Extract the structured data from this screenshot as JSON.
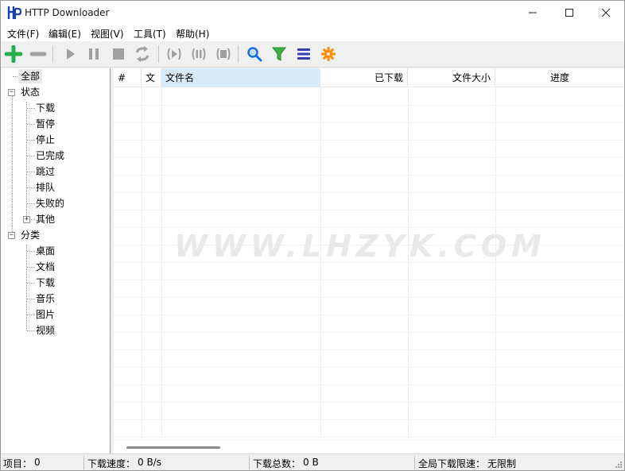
{
  "window": {
    "title": "HTTP Downloader",
    "logo_text": "HP"
  },
  "menu": {
    "items": [
      {
        "label": "文件(F)"
      },
      {
        "label": "编辑(E)"
      },
      {
        "label": "视图(V)"
      },
      {
        "label": "工具(T)"
      },
      {
        "label": "帮助(H)"
      }
    ]
  },
  "toolbar": {
    "buttons": [
      {
        "icon": "add-icon",
        "color": "#22b14c"
      },
      {
        "icon": "remove-icon",
        "color": "#a0a0a0"
      },
      {
        "icon": "start-icon",
        "color": "#a0a0a0"
      },
      {
        "icon": "pause-icon",
        "color": "#a0a0a0"
      },
      {
        "icon": "stop-icon",
        "color": "#a0a0a0"
      },
      {
        "icon": "restart-icon",
        "color": "#a0a0a0"
      },
      {
        "icon": "start-all-icon",
        "color": "#a0a0a0"
      },
      {
        "icon": "pause-all-icon",
        "color": "#a0a0a0"
      },
      {
        "icon": "stop-all-icon",
        "color": "#a0a0a0"
      },
      {
        "icon": "search-icon",
        "color": "#1e6fd9"
      },
      {
        "icon": "filter-icon",
        "color": "#3cb043"
      },
      {
        "icon": "list-icon",
        "color": "#3a3ab8"
      },
      {
        "icon": "settings-icon",
        "color": "#ff8c00"
      }
    ]
  },
  "tree": {
    "all": "全部",
    "status": {
      "label": "状态",
      "children": [
        "下载",
        "暂停",
        "停止",
        "已完成",
        "跳过",
        "排队",
        "失败的",
        "其他"
      ]
    },
    "category": {
      "label": "分类",
      "children": [
        "桌面",
        "文档",
        "下载",
        "音乐",
        "图片",
        "视频"
      ]
    }
  },
  "list": {
    "columns": [
      {
        "label": "#"
      },
      {
        "label": "文"
      },
      {
        "label": "文件名"
      },
      {
        "label": "已下载"
      },
      {
        "label": "文件大小"
      },
      {
        "label": "进度"
      }
    ],
    "rows": [],
    "watermark": "WWW.LHZYK.COM"
  },
  "statusbar": {
    "items_label": "项目：",
    "items_value": "0",
    "speed_label": "下载速度：",
    "speed_value": "0 B/s",
    "total_label": "下载总数：",
    "total_value": "0 B",
    "limit_label": "全局下载限速：",
    "limit_value": "无限制"
  }
}
